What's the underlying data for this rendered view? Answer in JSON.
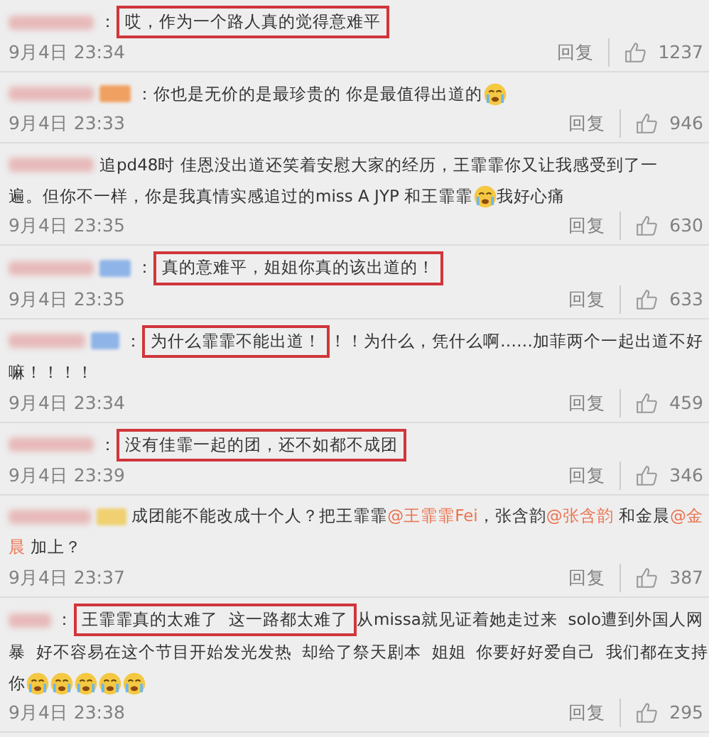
{
  "comments": [
    {
      "separator": "：",
      "lines": [
        [
          {
            "kind": "highlight",
            "text": "哎，作为一个路人真的觉得意难平"
          }
        ]
      ],
      "date": "9月4日 23:34",
      "reply": "回复",
      "likes": "1237"
    },
    {
      "badge": {
        "color": "#f0a060"
      },
      "separator": "：",
      "lines": [
        [
          {
            "kind": "text",
            "text": "你也是无价的是最珍贵的 你是最值得出道的"
          },
          {
            "kind": "emoji"
          }
        ]
      ],
      "date": "9月4日 23:33",
      "reply": "回复",
      "likes": "946"
    },
    {
      "lines": [
        [
          {
            "kind": "text",
            "text": "追pd48时 佳恩没出道还笑着安慰大家的经历，王霏霏你又让我感受到了一"
          }
        ],
        [
          {
            "kind": "text",
            "text": "遍。但你不一样，你是我真情实感追过的miss A JYP 和王霏霏"
          },
          {
            "kind": "emoji"
          },
          {
            "kind": "text",
            "text": "我好心痛"
          }
        ]
      ],
      "date": "9月4日 23:35",
      "reply": "回复",
      "likes": "630"
    },
    {
      "badge": {
        "color": "#8fb4e8"
      },
      "separator": "：",
      "lines": [
        [
          {
            "kind": "highlight",
            "text": "真的意难平，姐姐你真的该出道的！"
          }
        ]
      ],
      "date": "9月4日 23:35",
      "reply": "回复",
      "likes": "633"
    },
    {
      "badge": {
        "color": "#8fb4e8"
      },
      "separator": "：",
      "lines": [
        [
          {
            "kind": "highlight",
            "text": "为什么霏霏不能出道！"
          },
          {
            "kind": "text",
            "text": "！！为什么，凭什么啊……加菲两个一起出道不好"
          }
        ],
        [
          {
            "kind": "text",
            "text": "嘛！！！！"
          }
        ]
      ],
      "date": "9月4日 23:34",
      "reply": "回复",
      "likes": "459"
    },
    {
      "separator": "：",
      "lines": [
        [
          {
            "kind": "highlight",
            "text": "没有佳霏一起的团，还不如都不成团"
          }
        ]
      ],
      "date": "9月4日 23:39",
      "reply": "回复",
      "likes": "346"
    },
    {
      "badge": {
        "color": "#f0d070"
      },
      "lines": [
        [
          {
            "kind": "text",
            "text": "成团能不能改成十个人？把王霏霏"
          },
          {
            "kind": "mention",
            "text": "@王霏霏Fei"
          },
          {
            "kind": "text",
            "text": "，张含韵"
          },
          {
            "kind": "mention",
            "text": "@张含韵"
          },
          {
            "kind": "text",
            "text": " 和金晨"
          },
          {
            "kind": "mention",
            "text": "@金"
          }
        ],
        [
          {
            "kind": "mention",
            "text": "晨"
          },
          {
            "kind": "text",
            "text": " 加上？"
          }
        ]
      ],
      "date": "9月4日 23:37",
      "reply": "回复",
      "likes": "387"
    },
    {
      "separator": "：",
      "lines": [
        [
          {
            "kind": "highlight",
            "text": "王霏霏真的太难了  这一路都太难了"
          },
          {
            "kind": "text",
            "text": "从missa就见证着她走过来  solo遭到外国人网"
          }
        ],
        [
          {
            "kind": "text",
            "text": "暴  好不容易在这个节目开始发光发热  却给了祭天剧本  姐姐  你要好好爱自己  我们都在支持"
          }
        ],
        [
          {
            "kind": "text",
            "text": "你"
          },
          {
            "kind": "emoji"
          },
          {
            "kind": "emoji"
          },
          {
            "kind": "emoji"
          },
          {
            "kind": "emoji"
          },
          {
            "kind": "emoji"
          }
        ]
      ],
      "date": "9月4日 23:38",
      "reply": "回复",
      "likes": "295"
    }
  ]
}
